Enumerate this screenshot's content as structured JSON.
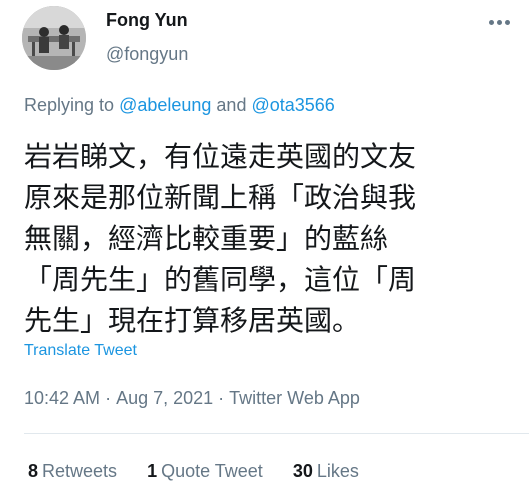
{
  "author": {
    "display_name": "Fong Yun",
    "handle": "@fongyun"
  },
  "menu": {
    "icon": "more-horizontal-icon"
  },
  "reply": {
    "prefix": "Replying to ",
    "users": [
      "@abeleung",
      "@ota3566"
    ],
    "joiner": " and "
  },
  "tweet": {
    "text": "岩岩睇文，有位遠走英國的文友\n原來是那位新聞上稱「政治與我\n無關，經濟比較重要」的藍絲\n「周先生」的舊同學，這位「周\n先生」現在打算移居英國。",
    "translate_label": "Translate Tweet",
    "time": "10:42 AM",
    "date": "Aug 7, 2021",
    "source": "Twitter Web App",
    "separator": "·"
  },
  "stats": {
    "retweets_count": "8",
    "retweets_label": "Retweets",
    "quotes_count": "1",
    "quotes_label": "Quote Tweet",
    "likes_count": "30",
    "likes_label": "Likes"
  },
  "colors": {
    "link": "#1b95e0",
    "secondary_text": "#657786",
    "primary_text": "#14171a",
    "divider": "#e1e8ed"
  }
}
